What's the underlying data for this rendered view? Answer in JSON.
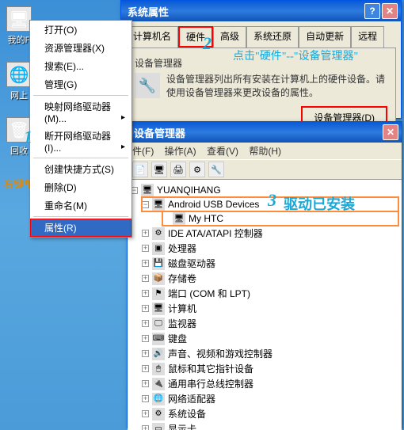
{
  "desktop": {
    "icons": [
      {
        "label": "我的F",
        "glyph": "🖥"
      },
      {
        "label": "网上",
        "glyph": "🌐"
      },
      {
        "label": "回收",
        "glyph": "🗑"
      }
    ],
    "hint": "右键单击\"我的电脑-属性"
  },
  "context_menu": {
    "items": [
      {
        "label": "打开(O)",
        "type": "item"
      },
      {
        "label": "资源管理器(X)",
        "type": "item"
      },
      {
        "label": "搜索(E)...",
        "type": "item"
      },
      {
        "label": "管理(G)",
        "type": "item"
      },
      {
        "type": "sep"
      },
      {
        "label": "映射网络驱动器(M)...",
        "type": "item"
      },
      {
        "label": "断开网络驱动器(I)...",
        "type": "item"
      },
      {
        "type": "sep"
      },
      {
        "label": "创建快捷方式(S)",
        "type": "item"
      },
      {
        "label": "删除(D)",
        "type": "item"
      },
      {
        "label": "重命名(M)",
        "type": "item"
      },
      {
        "type": "sep"
      },
      {
        "label": "属性(R)",
        "type": "item",
        "selected": true
      }
    ]
  },
  "sysprop": {
    "title": "系统属性",
    "tabs": [
      "计算机名",
      "硬件",
      "高级",
      "系统还原",
      "自动更新",
      "远程"
    ],
    "active_tab_index": 1,
    "group_title": "设备管理器",
    "group_desc": "设备管理器列出所有安装在计算机上的硬件设备。请使用设备管理器来更改设备的属性。",
    "button": "设备管理器(D)"
  },
  "devmgr": {
    "title": "设备管理器",
    "menu": [
      "件(F)",
      "操作(A)",
      "查看(V)",
      "帮助(H)"
    ],
    "toolbar_icons": [
      "📄",
      "🖥",
      "🖨",
      "⚙",
      "🔧"
    ],
    "root": "YUANQIHANG",
    "highlighted_group": "Android USB Devices",
    "highlighted_child": "My HTC",
    "nodes": [
      "IDE ATA/ATAPI 控制器",
      "处理器",
      "磁盘驱动器",
      "存储卷",
      "端口 (COM 和 LPT)",
      "计算机",
      "监视器",
      "键盘",
      "声音、视频和游戏控制器",
      "鼠标和其它指针设备",
      "通用串行总线控制器",
      "网络适配器",
      "系统设备",
      "显示卡"
    ]
  },
  "annotations": {
    "a1": "1",
    "a2": "2",
    "a2_hint": "点击\"硬件\"--\"设备管理器\"",
    "a3": "3",
    "a3_hint": "驱动已安装"
  },
  "colors": {
    "highlight_red": "#ff0000",
    "highlight_orange": "#ff8c3a",
    "anno_blue": "#1ba8d8"
  }
}
